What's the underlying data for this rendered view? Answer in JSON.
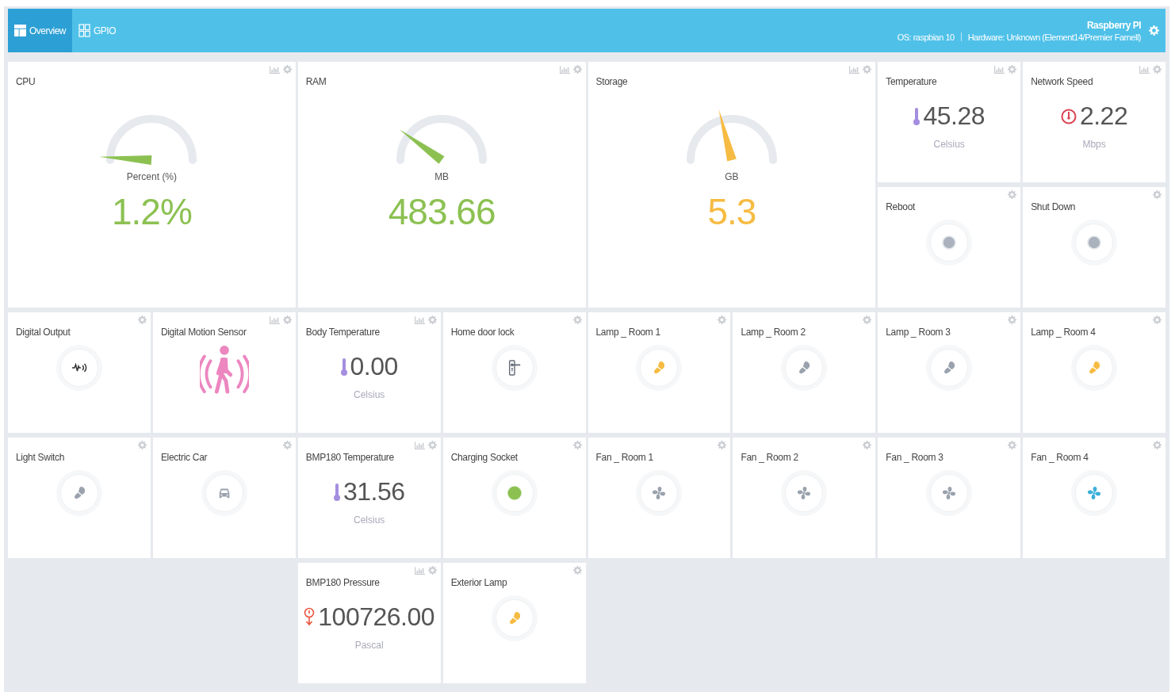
{
  "header": {
    "tabs": [
      {
        "label": "Overview",
        "selected": true
      },
      {
        "label": "GPIO",
        "selected": false
      }
    ],
    "device_name": "Raspberry PI",
    "os": "OS: raspbian 10",
    "hardware": "Hardware: Unknown (Element14/Premier Farnell)"
  },
  "widgets": [
    {
      "kind": "gauge",
      "title": "CPU",
      "unit": "Percent (%)",
      "value": "1.2%",
      "color": "#8cc152",
      "chart_button": true
    },
    {
      "kind": "gauge",
      "title": "RAM",
      "unit": "MB",
      "value": "483.66",
      "color": "#8cc152",
      "chart_button": true
    },
    {
      "kind": "gauge",
      "title": "Storage",
      "unit": "GB",
      "value": "5.3",
      "color": "#f6bb42",
      "chart_button": true
    },
    {
      "kind": "temperature",
      "title": "Temperature",
      "value": "45.28",
      "unit": "Celsius",
      "chart_button": true
    },
    {
      "kind": "speed",
      "title": "Network Speed",
      "value": "2.22",
      "unit": "Mbps",
      "chart_button": true
    },
    {
      "kind": "button",
      "title": "Reboot",
      "chart_button": false
    },
    {
      "kind": "button",
      "title": "Shut Down",
      "chart_button": false
    },
    {
      "kind": "output",
      "title": "Digital Output",
      "on": false,
      "chart_button": false
    },
    {
      "kind": "motion",
      "title": "Digital Motion Sensor",
      "chart_button": true
    },
    {
      "kind": "temperature",
      "title": "Body Temperature",
      "value": "0.00",
      "unit": "Celsius",
      "chart_button": true
    },
    {
      "kind": "lock",
      "title": "Home door lock",
      "chart_button": false
    },
    {
      "kind": "lamp",
      "title": "Lamp _ Room 1",
      "on": true,
      "chart_button": false
    },
    {
      "kind": "lamp",
      "title": "Lamp _ Room 2",
      "on": false,
      "chart_button": false
    },
    {
      "kind": "lamp",
      "title": "Lamp _ Room 3",
      "on": false,
      "chart_button": false
    },
    {
      "kind": "lamp",
      "title": "Lamp _ Room 4",
      "on": true,
      "chart_button": false
    },
    {
      "kind": "lamp",
      "title": "Light Switch",
      "on": false,
      "chart_button": false
    },
    {
      "kind": "car",
      "title": "Electric Car",
      "chart_button": false
    },
    {
      "kind": "temperature",
      "title": "BMP180 Temperature",
      "value": "31.56",
      "unit": "Celsius",
      "chart_button": true
    },
    {
      "kind": "socket",
      "title": "Charging Socket",
      "on": true,
      "chart_button": false
    },
    {
      "kind": "fan",
      "title": "Fan _ Room 1",
      "on": false,
      "chart_button": false
    },
    {
      "kind": "fan",
      "title": "Fan _ Room 2",
      "on": false,
      "chart_button": false
    },
    {
      "kind": "fan",
      "title": "Fan _ Room 3",
      "on": false,
      "chart_button": false
    },
    {
      "kind": "fan",
      "title": "Fan _ Room 4",
      "on": true,
      "chart_button": false
    },
    {
      "kind": "pressure",
      "title": "BMP180 Pressure",
      "value": "100726.00",
      "unit": "Pascal",
      "chart_button": true
    },
    {
      "kind": "lamp",
      "title": "Exterior Lamp",
      "on": true,
      "chart_button": false
    }
  ]
}
